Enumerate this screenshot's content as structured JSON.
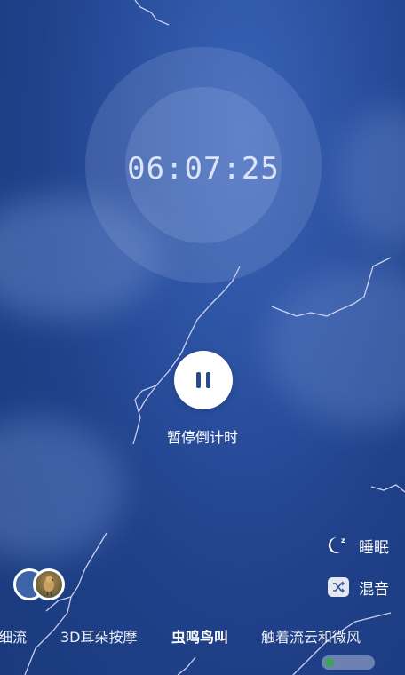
{
  "timer": {
    "time": "06:07:25"
  },
  "controls": {
    "pause_label": "暂停倒计时"
  },
  "side_actions": [
    {
      "label": "睡眠",
      "icon": "moon-icon"
    },
    {
      "label": "混音",
      "icon": "shuffle-icon"
    }
  ],
  "categories": [
    {
      "label": "细流",
      "active": false
    },
    {
      "label": "3D耳朵按摩",
      "active": false
    },
    {
      "label": "虫鸣鸟叫",
      "active": true
    },
    {
      "label": "触着流云和微风",
      "active": false
    }
  ],
  "colors": {
    "accent": "#2a4a8c",
    "background": "#20418a"
  }
}
